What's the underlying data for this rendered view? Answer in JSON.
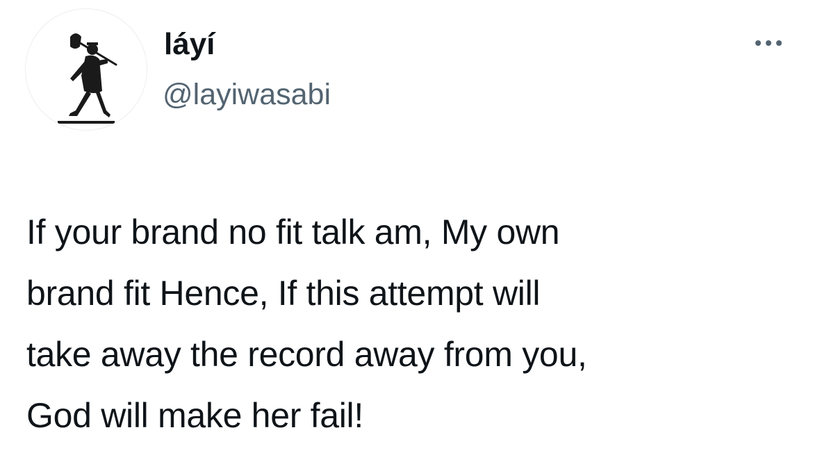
{
  "author": {
    "display_name": "láyí",
    "handle": "@layiwasabi",
    "avatar_icon": "walking-man-with-bindle-icon"
  },
  "more_icon": "more-options-icon",
  "tweet": {
    "text": "If your brand no fit talk am, My own\nbrand fit Hence, If this attempt will\ntake away the record away from you,\nGod will make her fail!"
  },
  "colors": {
    "primary_text": "#0f1419",
    "secondary_text": "#536471",
    "background": "#ffffff"
  }
}
